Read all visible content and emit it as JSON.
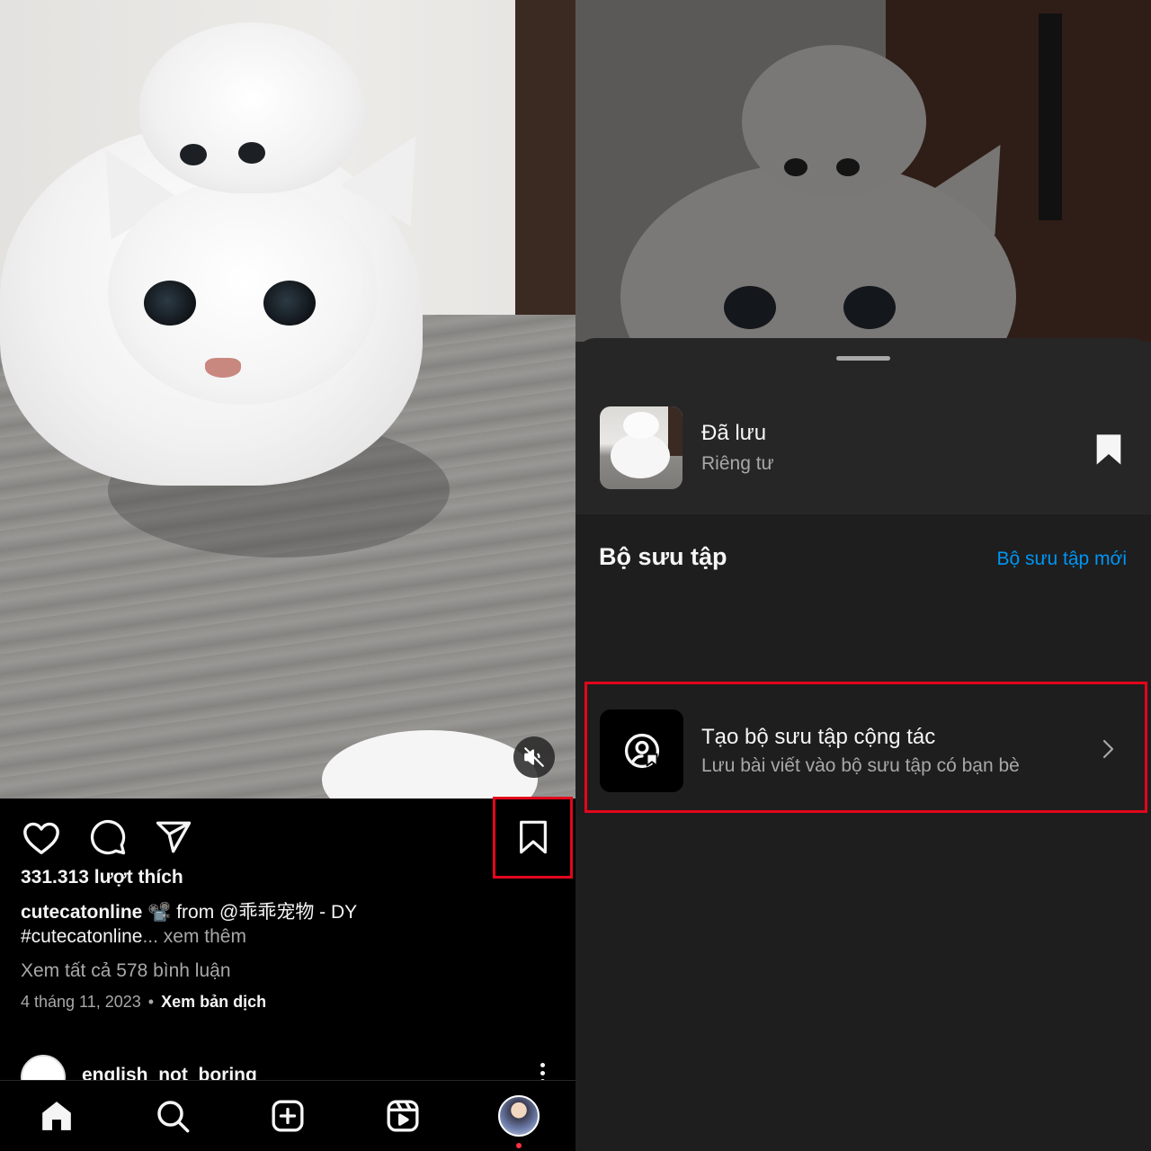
{
  "left": {
    "post": {
      "likes": "331.313 lượt thích",
      "username": "cutecatonline",
      "caption_rest": "📽️ from @乖乖宠物 - DY",
      "hashtag": "#cutecatonline",
      "more": "... xem thêm",
      "comments_link": "Xem tất cả 578 bình luận",
      "date": "4 tháng 11, 2023",
      "separator": "•",
      "translate": "Xem bản dịch"
    },
    "next_post": {
      "username": "english_not_boring"
    },
    "icons": {
      "like": "heart-icon",
      "comment": "comment-icon",
      "share": "send-icon",
      "save": "bookmark-icon",
      "mute": "speaker-muted-icon"
    },
    "nav": [
      "home-icon",
      "search-icon",
      "create-icon",
      "reels-icon",
      "profile-avatar"
    ]
  },
  "right": {
    "saved": {
      "title": "Đã lưu",
      "subtitle": "Riêng tư"
    },
    "collections": {
      "heading": "Bộ sưu tập",
      "new_link": "Bộ sưu tập mới"
    },
    "collab": {
      "title": "Tạo bộ sưu tập cộng tác",
      "subtitle": "Lưu bài viết vào bộ sưu tập có bạn bè"
    }
  },
  "colors": {
    "highlight": "#e3061b",
    "link_blue": "#0095f6",
    "sheet_bg": "#262626",
    "section_bg": "#1e1e1e"
  }
}
